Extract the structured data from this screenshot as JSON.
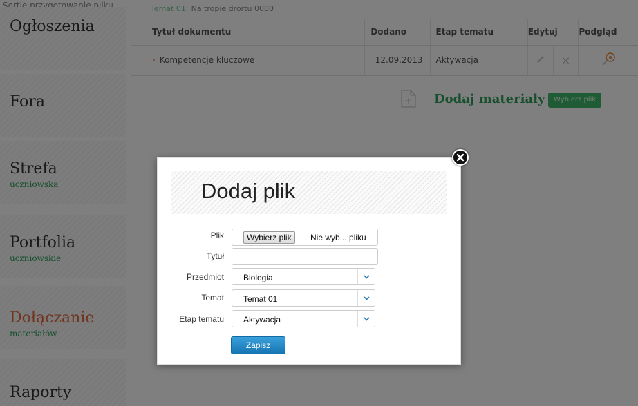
{
  "top_caption": "Sortie przygotowanie pliku",
  "topic": {
    "label": "Temat 01:",
    "text": "Na tropie drortu 0000"
  },
  "sidebar": {
    "items": [
      {
        "title": "Ogłoszenia",
        "subtitle": ""
      },
      {
        "title": "Fora",
        "subtitle": ""
      },
      {
        "title": "Strefa",
        "subtitle": "uczniowska"
      },
      {
        "title": "Portfolia",
        "subtitle": "uczniowskie"
      },
      {
        "title": "Dołączanie",
        "subtitle": "materiałów"
      },
      {
        "title": "Raporty",
        "subtitle": ""
      }
    ]
  },
  "table": {
    "headers": [
      "Tytuł dokumentu",
      "Dodano",
      "Etap tematu",
      "Edytuj",
      "Podgląd"
    ],
    "rows": [
      {
        "title": "Kompetencje kluczowe",
        "added": "12.09.2013",
        "stage": "Aktywacja"
      }
    ]
  },
  "add_materials": {
    "label": "Dodaj materiały",
    "button": "Wybierz plik"
  },
  "modal": {
    "title": "Dodaj plik",
    "labels": {
      "file": "Plik",
      "title": "Tytuł",
      "subject": "Przedmiot",
      "topic": "Temat",
      "stage": "Etap tematu"
    },
    "file_button": "Wybierz plik",
    "file_status": "Nie wyb... pliku",
    "title_value": "",
    "subject_value": "Biologia",
    "topic_value": "Temat 01",
    "stage_value": "Aktywacja",
    "save_label": "Zapisz"
  },
  "colors": {
    "accent_green": "#2e9e5b",
    "accent_orange": "#e0683c",
    "primary_button": "#1f86c8"
  }
}
